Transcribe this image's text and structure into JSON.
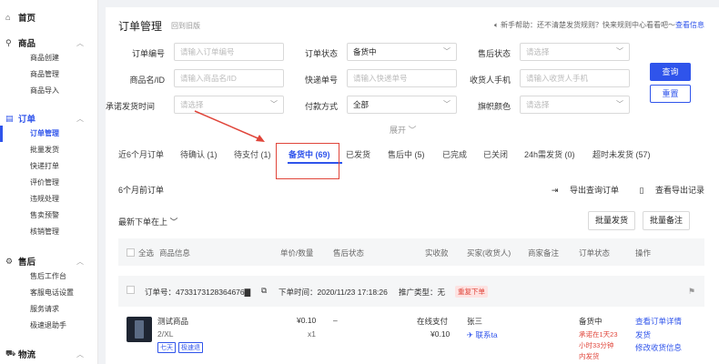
{
  "sidebar": {
    "groups": [
      {
        "icon": "home-icon",
        "glyph": "⌂",
        "label": "首页",
        "items": []
      },
      {
        "icon": "bag-icon",
        "glyph": "⚲",
        "label": "商品",
        "items": [
          "商品创建",
          "商品管理",
          "商品导入"
        ]
      },
      {
        "icon": "order-icon",
        "glyph": "▤",
        "label": "订单",
        "items": [
          "订单管理",
          "批量发货",
          "快递打单",
          "评价管理",
          "违规处理",
          "售卖预警",
          "核销管理"
        ]
      },
      {
        "icon": "aftersale-icon",
        "glyph": "⚙",
        "label": "售后",
        "items": [
          "售后工作台",
          "客服电话设置",
          "服务请求",
          "极速退助手"
        ]
      },
      {
        "icon": "truck-icon",
        "glyph": "⛟",
        "label": "物流",
        "items": []
      }
    ]
  },
  "header": {
    "title": "订单管理",
    "back_link": "回到旧版",
    "help_text": "新手帮助：还不清楚发货规则？快来规则中心看看吧～",
    "help_link": "查看信息"
  },
  "filters": {
    "order_no": {
      "label": "订单编号",
      "placeholder": "请输入订单编号"
    },
    "order_status": {
      "label": "订单状态",
      "value": "备货中"
    },
    "aftersale_status": {
      "label": "售后状态",
      "placeholder": "请选择"
    },
    "product_name": {
      "label": "商品名/ID",
      "placeholder": "请输入商品名/ID"
    },
    "tracking_no": {
      "label": "快递单号",
      "placeholder": "请输入快递单号"
    },
    "receiver_phone": {
      "label": "收货人手机",
      "placeholder": "请输入收货人手机"
    },
    "ship_time": {
      "label": "承诺发货时间",
      "placeholder": "请选择"
    },
    "pay_method": {
      "label": "付款方式",
      "value": "全部"
    },
    "flag_color": {
      "label": "旗帜颜色",
      "placeholder": "请选择"
    },
    "query_button": "查询",
    "reset_button": "重置",
    "expand_label": "展开"
  },
  "tabs": [
    "近6个月订单",
    "待确认 (1)",
    "待支付 (1)",
    "备货中 (69)",
    "已发货",
    "售后中 (5)",
    "已完成",
    "已关闭",
    "24h需发货 (0)",
    "超时未发货 (57)"
  ],
  "subbar": {
    "range_label": "6个月前订单",
    "export_query": "导出查询订单",
    "view_exports": "查看导出记录",
    "sort_label": "最新下单在上",
    "batch_ship": "批量发货",
    "batch_note": "批量备注"
  },
  "table": {
    "headers": [
      "全选",
      "商品信息",
      "单价/数量",
      "售后状态",
      "实收款",
      "买家(收货人)",
      "商家备注",
      "订单状态",
      "操作"
    ]
  },
  "order": {
    "order_no": "订单号：4733173128364676▇",
    "order_time": "下单时间：2020/11/23 17:18:26",
    "promo_type": "推广类型：无",
    "tag": "重复下单",
    "product_name": "测试商品",
    "spec": "2/XL",
    "tags": [
      "七天",
      "极速退"
    ],
    "price": "¥0.10",
    "qty": "x1",
    "aftersale": "–",
    "pay_method": "在线支付",
    "paid": "¥0.10",
    "buyer": "张三",
    "contact": "联系ta",
    "status": "备货中",
    "countdown_1": "承诺在1天23",
    "countdown_2": "小时33分钟",
    "countdown_3": "内发货",
    "actions": [
      "查看订单详情",
      "发货",
      "修改收货信息"
    ]
  },
  "colors": {
    "accent": "#2f54eb",
    "annotation": "#e0453a"
  }
}
